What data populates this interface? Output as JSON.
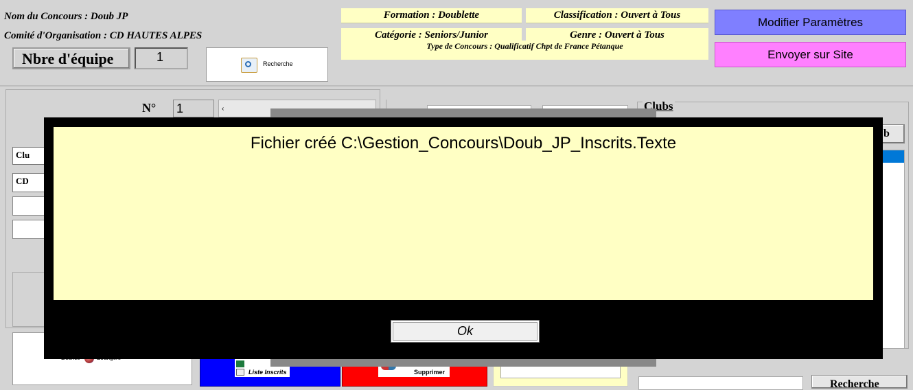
{
  "header": {
    "nom_concours": "Nom du Concours : Doub  JP",
    "comite": "Comité d'Organisation : CD HAUTES ALPES",
    "nbre_label": "Nbre d'équipe",
    "nbre_value": "1",
    "recherche_label": "Recherche",
    "formation": "Formation : Doublette",
    "classification": "Classification : Ouvert à Tous",
    "categorie": "Catégorie : Seniors/Junior",
    "genre": "Genre : Ouvert à Tous",
    "type_concours": "Type de Concours : Qualificatif Chpt de France Pétanque",
    "modifier_button": "Modifier Paramètres",
    "envoyer_button": "Envoyer sur Site"
  },
  "form": {
    "numero_label": "N°",
    "numero_value": "1",
    "club_label": "Clu",
    "cd_label": "CD",
    "clubs_heading": "Clubs",
    "club_btn_tail": "b",
    "licence_label": "Licence",
    "etrangere_label": "Etrangère",
    "liste_inscrits": "Liste Inscrits",
    "supprimer": "Supprimer",
    "recherche_bottom": "Recherche"
  },
  "colors": {
    "modifier_bg": "#7f7fff",
    "envoyer_bg": "#ff80ff",
    "yellow_bg": "#ffffc4",
    "dialog_bg": "#000000",
    "blue_panel": "#0000ff",
    "red_panel": "#ff0000",
    "list_highlight": "#0078d7"
  },
  "dialog": {
    "message": "Fichier créé C:\\Gestion_Concours\\Doub_JP_Inscrits.Texte",
    "ok_button": "Ok"
  }
}
